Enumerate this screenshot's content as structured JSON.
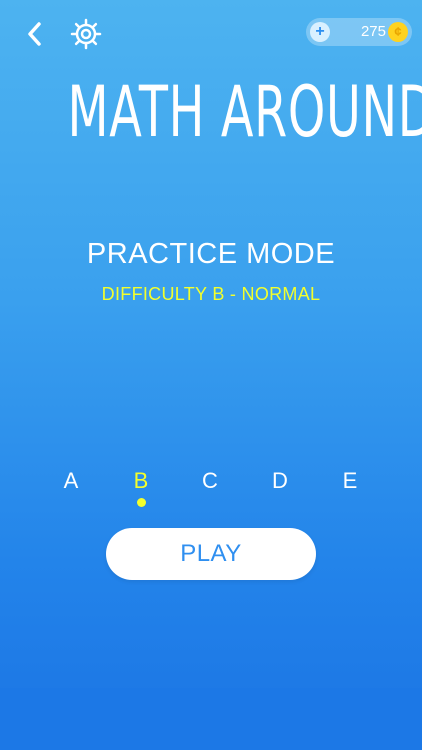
{
  "top_bar": {
    "back_icon": "chevron-left-icon",
    "settings_icon": "gear-icon",
    "coin_add_label": "+",
    "coin_amount": "275",
    "coin_symbol": "¢"
  },
  "app_title": "MATH AROUND",
  "mode": {
    "title": "PRACTICE MODE",
    "difficulty_label": "DIFFICULTY B - NORMAL"
  },
  "difficulty_options": [
    {
      "label": "A",
      "selected": false
    },
    {
      "label": "B",
      "selected": true
    },
    {
      "label": "C",
      "selected": false
    },
    {
      "label": "D",
      "selected": false
    },
    {
      "label": "E",
      "selected": false
    }
  ],
  "play_label": "PLAY",
  "colors": {
    "background_top": "#4db3f0",
    "background_bottom": "#1b74e4",
    "highlight": "#f3ff2c",
    "button_text": "#2f8ff0",
    "coin": "#ffd21f"
  }
}
